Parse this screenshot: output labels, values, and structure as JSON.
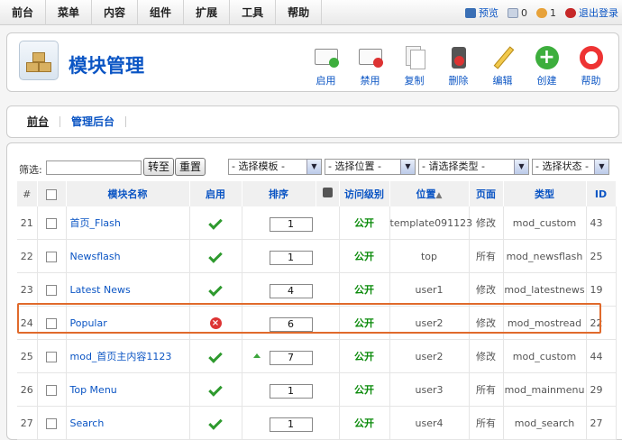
{
  "menu": [
    "前台",
    "菜单",
    "内容",
    "组件",
    "扩展",
    "工具",
    "帮助"
  ],
  "status": {
    "preview": "预览",
    "messages": "0",
    "users": "1",
    "logout": "退出登录"
  },
  "page": {
    "title": "模块管理"
  },
  "toolbar": [
    {
      "label": "启用",
      "icon": "enable-icon"
    },
    {
      "label": "禁用",
      "icon": "disable-icon"
    },
    {
      "label": "复制",
      "icon": "copy-icon"
    },
    {
      "label": "删除",
      "icon": "delete-icon"
    },
    {
      "label": "编辑",
      "icon": "edit-icon"
    },
    {
      "label": "创建",
      "icon": "new-icon"
    },
    {
      "label": "帮助",
      "icon": "help-icon"
    }
  ],
  "subtabs": [
    "前台",
    "管理后台"
  ],
  "filter": {
    "label": "筛选:",
    "value": "",
    "go": "转至",
    "reset": "重置",
    "selects": [
      "- 选择模板 -",
      "- 选择位置 -",
      "- 请选择类型 -",
      "- 选择状态 -"
    ]
  },
  "table": {
    "headers": [
      "#",
      "",
      "模块名称",
      "启用",
      "排序",
      "",
      "访问级别",
      "位置",
      "页面",
      "类型",
      "ID"
    ],
    "rows": [
      {
        "num": "21",
        "name": "首页_Flash",
        "enabled": true,
        "order": "1",
        "arrow": "",
        "access": "公开",
        "position": "template091123",
        "pages": "修改",
        "type": "mod_custom",
        "id": "43"
      },
      {
        "num": "22",
        "name": "Newsflash",
        "enabled": true,
        "order": "1",
        "arrow": "",
        "access": "公开",
        "position": "top",
        "pages": "所有",
        "type": "mod_newsflash",
        "id": "25"
      },
      {
        "num": "23",
        "name": "Latest News",
        "enabled": true,
        "order": "4",
        "arrow": "",
        "access": "公开",
        "position": "user1",
        "pages": "修改",
        "type": "mod_latestnews",
        "id": "19"
      },
      {
        "num": "24",
        "name": "Popular",
        "enabled": false,
        "order": "6",
        "arrow": "down",
        "access": "公开",
        "position": "user2",
        "pages": "修改",
        "type": "mod_mostread",
        "id": "22"
      },
      {
        "num": "25",
        "name": "mod_首页主内容1123",
        "enabled": true,
        "order": "7",
        "arrow": "up",
        "access": "公开",
        "position": "user2",
        "pages": "修改",
        "type": "mod_custom",
        "id": "44"
      },
      {
        "num": "26",
        "name": "Top Menu",
        "enabled": true,
        "order": "1",
        "arrow": "",
        "access": "公开",
        "position": "user3",
        "pages": "所有",
        "type": "mod_mainmenu",
        "id": "29"
      },
      {
        "num": "27",
        "name": "Search",
        "enabled": true,
        "order": "1",
        "arrow": "",
        "access": "公开",
        "position": "user4",
        "pages": "所有",
        "type": "mod_search",
        "id": "27"
      }
    ]
  }
}
